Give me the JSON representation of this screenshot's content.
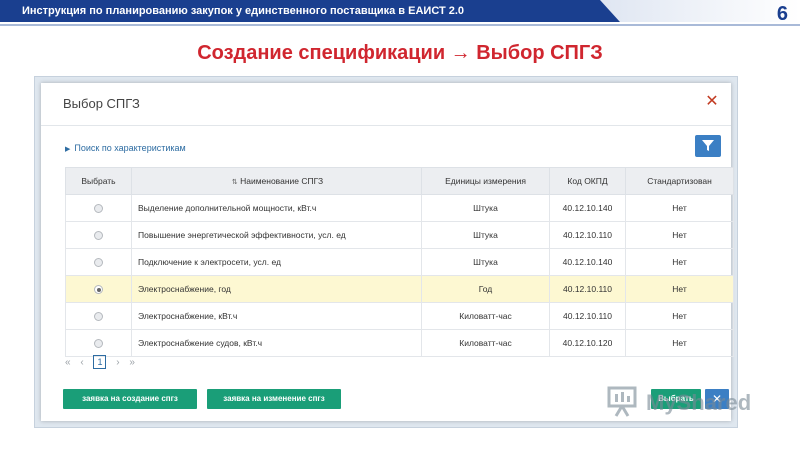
{
  "slide": {
    "header_title": "Инструкция по планированию  закупок у единственного поставщика в ЕАИСТ 2.0",
    "page_number": "6",
    "heading": "Создание спецификации → Выбор СПГЗ"
  },
  "dialog": {
    "title": "Выбор СПГЗ",
    "close_icon": "close-icon",
    "search_link": "Поиск по характеристикам",
    "filter_icon": "filter-icon",
    "columns": [
      "Выбрать",
      "Наименование СПГЗ",
      "Единицы измерения",
      "Код ОКПД",
      "Стандартизован"
    ],
    "rows": [
      {
        "name": "Выделение дополнительной мощности, кВт.ч",
        "unit": "Штука",
        "okpd": "40.12.10.140",
        "std": "Нет",
        "selected": false
      },
      {
        "name": "Повышение энергетической эффективности, усл. ед",
        "unit": "Штука",
        "okpd": "40.12.10.110",
        "std": "Нет",
        "selected": false
      },
      {
        "name": "Подключение к электросети, усл. ед",
        "unit": "Штука",
        "okpd": "40.12.10.140",
        "std": "Нет",
        "selected": false
      },
      {
        "name": "Электроснабжение, год",
        "unit": "Год",
        "okpd": "40.12.10.110",
        "std": "Нет",
        "selected": true
      },
      {
        "name": "Электроснабжение, кВт.ч",
        "unit": "Киловатт-час",
        "okpd": "40.12.10.110",
        "std": "Нет",
        "selected": false
      },
      {
        "name": "Электроснабжение судов, кВт.ч",
        "unit": "Киловатт-час",
        "okpd": "40.12.10.120",
        "std": "Нет",
        "selected": false
      }
    ],
    "pager": {
      "first": "«",
      "prev": "‹",
      "page": "1",
      "next": "›",
      "last": "»"
    },
    "buttons": {
      "create": "заявка на создание спгз",
      "change": "заявка на изменение спгз",
      "select": "Выбрать",
      "cancel": "✕"
    }
  },
  "watermark": {
    "text": "MyShared"
  },
  "colors": {
    "header_band": "#1a3f8f",
    "heading": "#d0262f",
    "button_green": "#1a9e78",
    "button_blue": "#3b7fc4",
    "selected_row": "#fdf8d2"
  }
}
